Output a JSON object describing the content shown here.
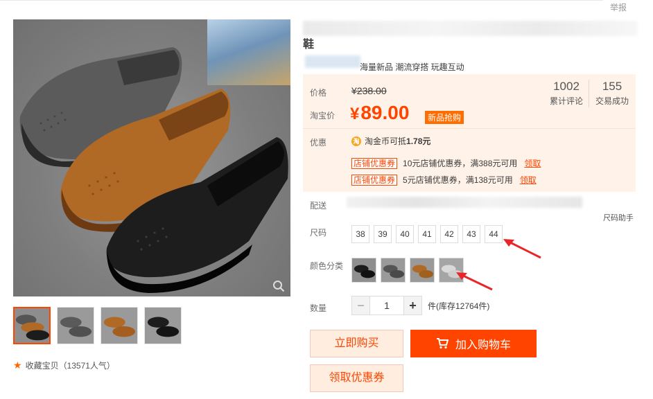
{
  "header": {
    "report": "举报"
  },
  "product": {
    "title": "鞋",
    "subtitle": "海量新品 潮流穿搭 玩趣互动"
  },
  "price": {
    "original_label": "价格",
    "original_value": "¥238.00",
    "current_label": "淘宝价",
    "current_symbol": "¥",
    "current_value": "89.00",
    "badge": "新品抢购"
  },
  "stats": [
    {
      "num": "1002",
      "label": "累计评论"
    },
    {
      "num": "155",
      "label": "交易成功"
    }
  ],
  "promo": {
    "label": "优惠",
    "coin_prefix": "淘金币可抵",
    "coin_amount": "1.78元",
    "coupons": [
      {
        "tag": "店铺优惠券",
        "text": "10元店铺优惠券，满388元可用",
        "action": "领取"
      },
      {
        "tag": "店铺优惠券",
        "text": "5元店铺优惠券，满138元可用",
        "action": "领取"
      }
    ]
  },
  "shipping": {
    "label": "配送",
    "size_help": "尺码助手"
  },
  "sizes": {
    "label": "尺码",
    "options": [
      "38",
      "39",
      "40",
      "41",
      "42",
      "43",
      "44"
    ]
  },
  "colors": {
    "label": "颜色分类"
  },
  "quantity": {
    "label": "数量",
    "value": "1",
    "stock": "件(库存12764件)"
  },
  "actions": {
    "buy": "立即购买",
    "cart": "加入购物车",
    "coupon": "领取优惠券"
  },
  "favorite": {
    "text": "收藏宝贝（13571人气）"
  },
  "theme": {
    "accent": "#ff4400",
    "price_bg": "#fff2e8",
    "arrow": "#e8262a"
  }
}
